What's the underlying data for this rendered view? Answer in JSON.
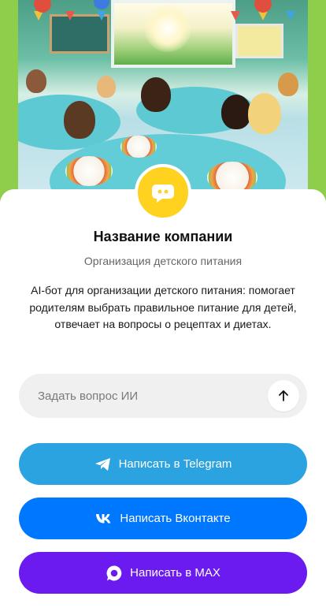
{
  "hero": {
    "image": "children-dining-room-illustration"
  },
  "company": {
    "logo_icon": "chat-bubble-icon",
    "name": "Название компании",
    "subtitle": "Организация детского питания",
    "description": "AI-бот для организации детского питания: помогает родителям выбрать правильное питание для детей, отвечает на вопросы о рецептах и диетах."
  },
  "ask": {
    "placeholder": "Задать вопрос ИИ",
    "value": "",
    "send_icon": "arrow-up-icon"
  },
  "buttons": {
    "telegram": {
      "label": "Написать в Telegram",
      "icon": "telegram-icon",
      "color": "#2aa3e0"
    },
    "vk": {
      "label": "Написать Вконтакте",
      "icon": "vk-icon",
      "color": "#0077ff"
    },
    "max": {
      "label": "Написать в MAX",
      "icon": "max-icon",
      "color": "#6b1bf0"
    }
  },
  "colors": {
    "page_background": "#8fce4a",
    "logo_background": "#ffd21f"
  }
}
